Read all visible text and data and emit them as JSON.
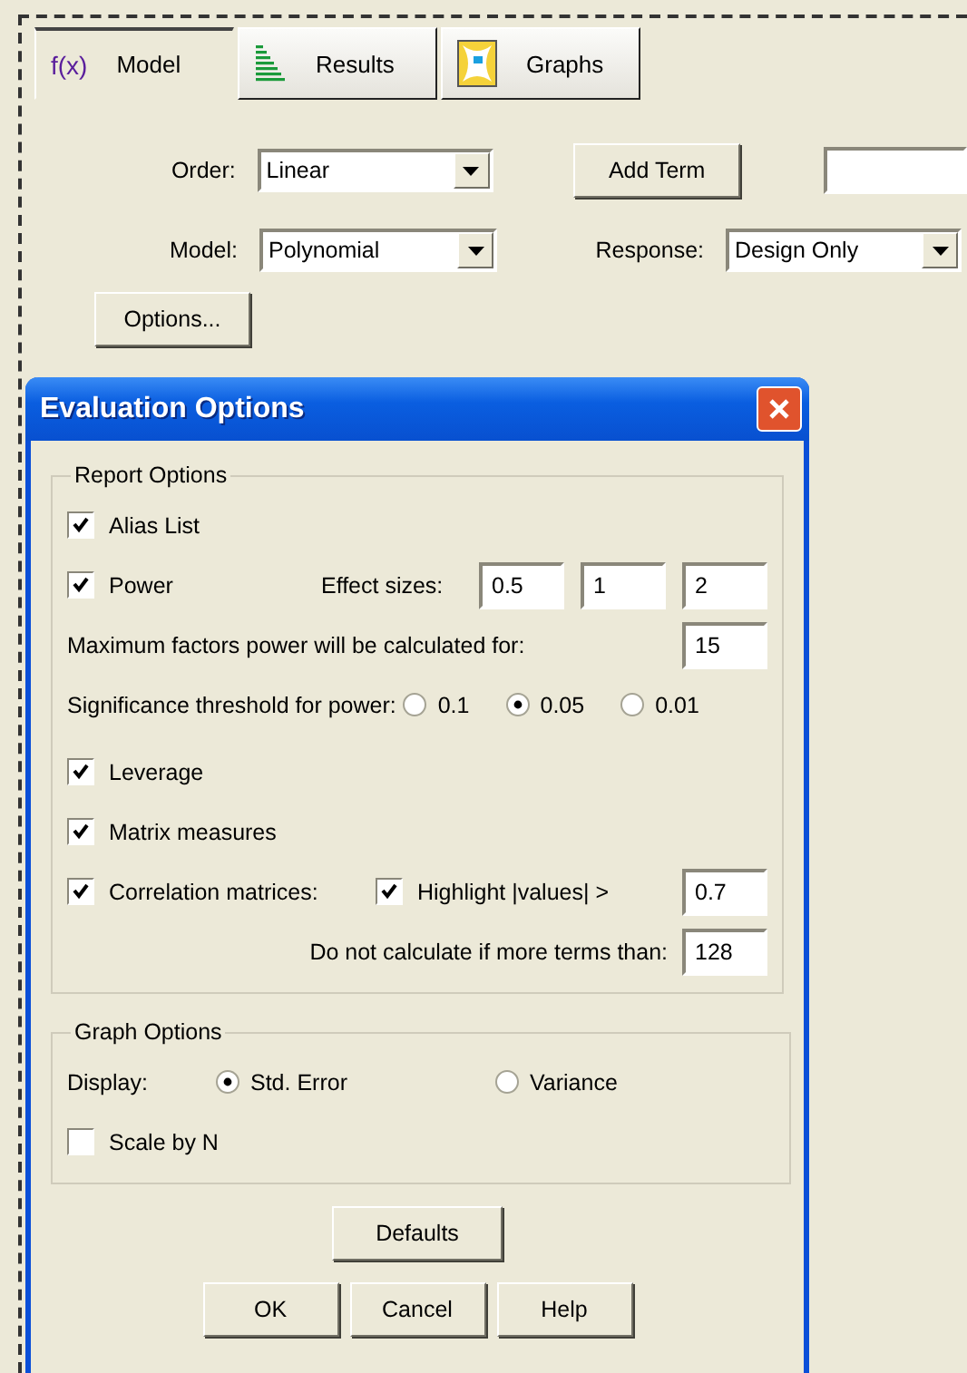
{
  "tabs": [
    {
      "label": "Model",
      "kind": "formula",
      "icon_text": "f(x)",
      "selected": true
    },
    {
      "label": "Results",
      "kind": "results",
      "selected": false
    },
    {
      "label": "Graphs",
      "kind": "graphs",
      "selected": false
    }
  ],
  "model_form": {
    "order": {
      "label": "Order:",
      "value": "Linear"
    },
    "add_term": "Add Term",
    "model": {
      "label": "Model:",
      "value": "Polynomial"
    },
    "response": {
      "label": "Response:",
      "value": "Design Only"
    },
    "options_button": "Options..."
  },
  "dialog": {
    "title": "Evaluation Options",
    "report_options": {
      "legend": "Report Options",
      "alias_list": {
        "label": "Alias List",
        "checked": true
      },
      "power": {
        "label": "Power",
        "checked": true,
        "effect_sizes_label": "Effect sizes:",
        "effect_sizes": [
          "0.5",
          "1",
          "2"
        ]
      },
      "max_factors": {
        "label": "Maximum factors power will be calculated for:",
        "value": "15"
      },
      "significance": {
        "label": "Significance threshold for power:",
        "options": [
          {
            "label": "0.1",
            "selected": false
          },
          {
            "label": "0.05",
            "selected": true
          },
          {
            "label": "0.01",
            "selected": false
          }
        ]
      },
      "leverage": {
        "label": "Leverage",
        "checked": true
      },
      "matrix_measures": {
        "label": "Matrix measures",
        "checked": true
      },
      "correlation": {
        "label": "Correlation matrices:",
        "checked": true,
        "highlight": {
          "label": "Highlight |values| >",
          "checked": true,
          "value": "0.7"
        }
      },
      "terms_limit": {
        "label": "Do not calculate if more terms than:",
        "value": "128"
      }
    },
    "graph_options": {
      "legend": "Graph Options",
      "display": {
        "label": "Display:",
        "options": [
          {
            "label": "Std. Error",
            "selected": true
          },
          {
            "label": "Variance",
            "selected": false
          }
        ]
      },
      "scale_by_n": {
        "label": "Scale by N",
        "checked": false
      }
    },
    "defaults_button": "Defaults",
    "buttons": [
      "OK",
      "Cancel",
      "Help"
    ]
  }
}
